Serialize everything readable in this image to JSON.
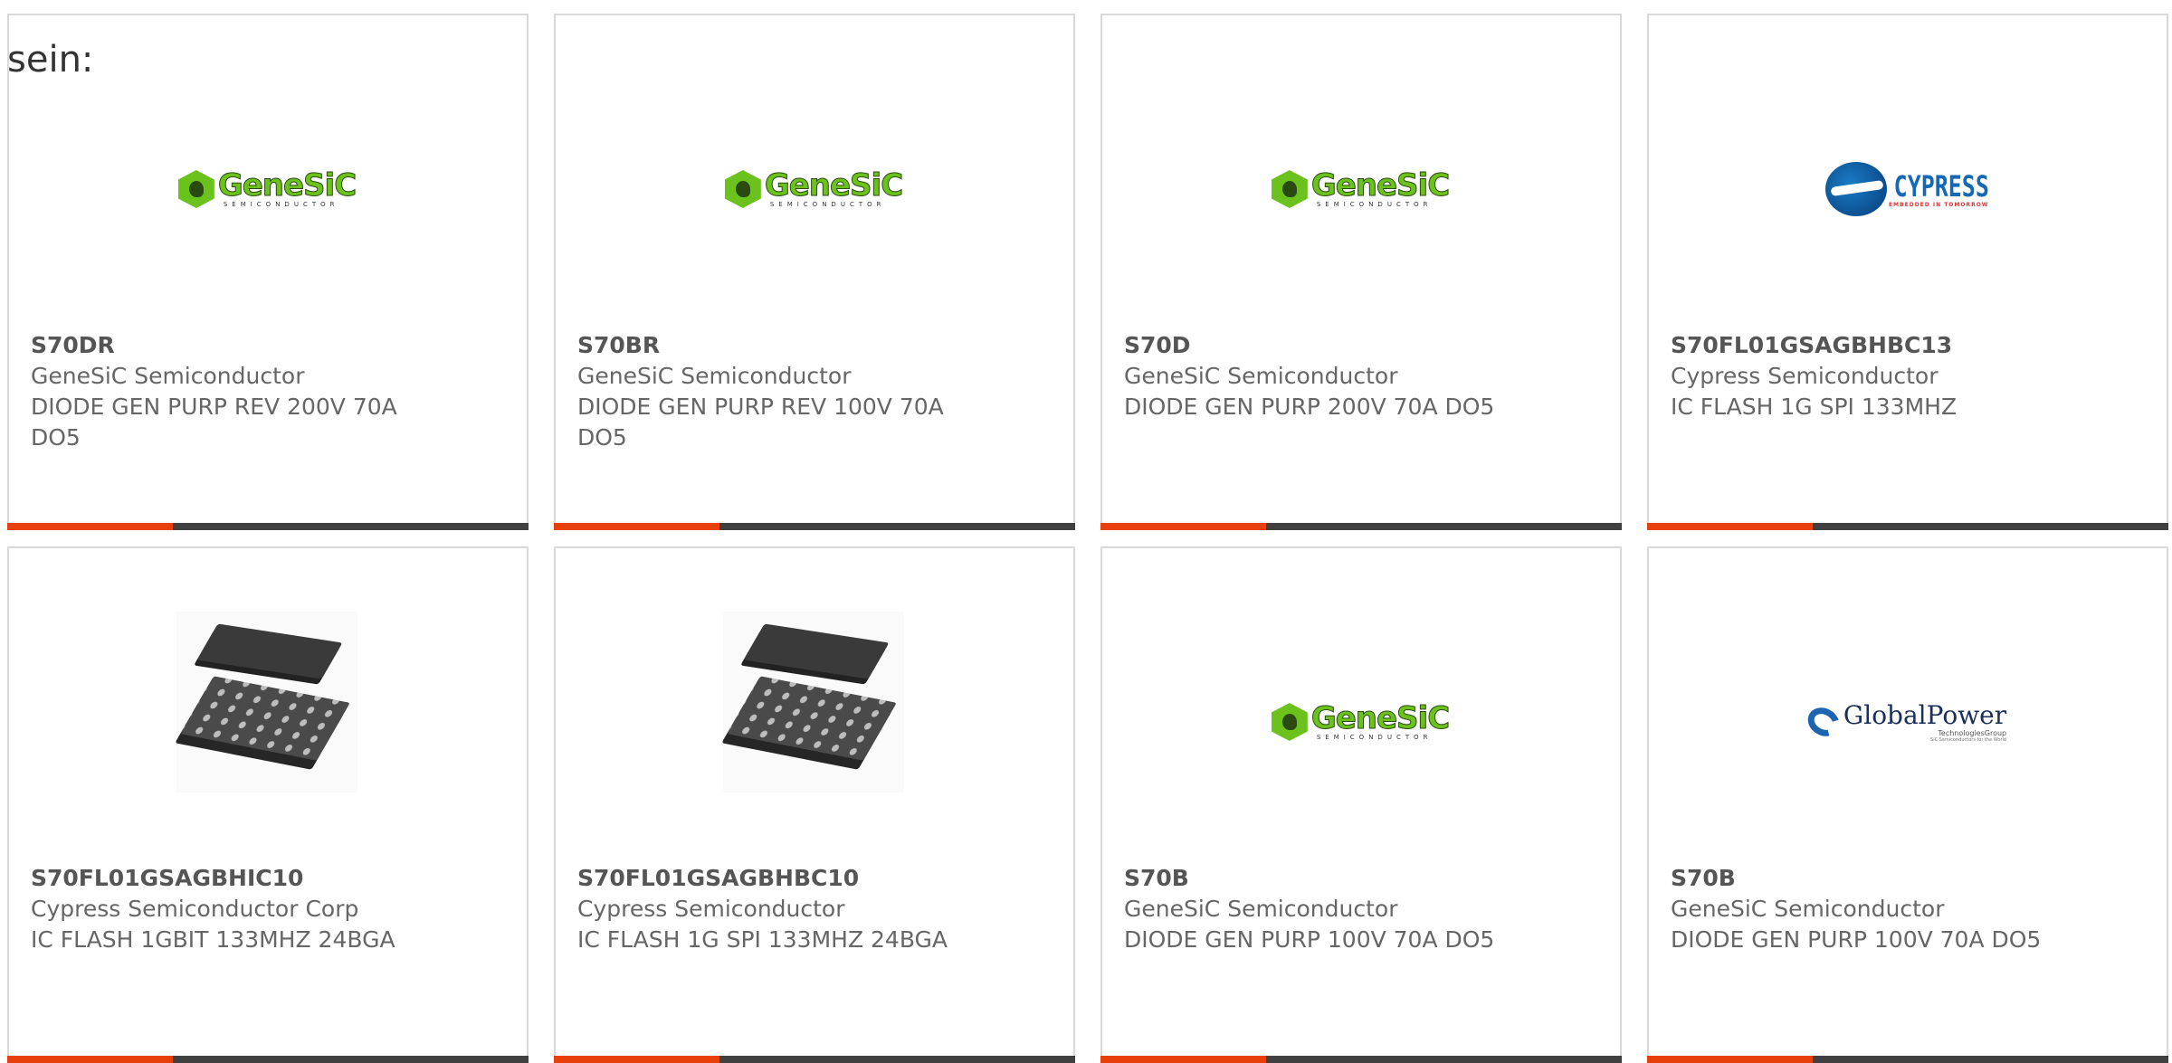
{
  "intro_text": "sein:",
  "colors": {
    "accent": "#e8400b",
    "bar": "#404040",
    "genesic_green": "#6cc21d",
    "cypress_blue": "#1568b4"
  },
  "logos": {
    "genesic": {
      "name": "GeneSiC",
      "sub": "SEMICONDUCTOR"
    },
    "cypress": {
      "name": "CYPRESS",
      "tag": "EMBEDDED IN TOMORROW"
    },
    "globalpower": {
      "name": "GlobalPower",
      "sub": "TechnologiesGroup",
      "sub2": "SiC Semiconductors for the World"
    }
  },
  "products": [
    {
      "part": "S70DR",
      "manufacturer": "GeneSiC Semiconductor",
      "description": "DIODE GEN PURP REV 200V 70A DO5",
      "image": "genesic-logo"
    },
    {
      "part": "S70BR",
      "manufacturer": "GeneSiC Semiconductor",
      "description": "DIODE GEN PURP REV 100V 70A DO5",
      "image": "genesic-logo"
    },
    {
      "part": "S70D",
      "manufacturer": "GeneSiC Semiconductor",
      "description": "DIODE GEN PURP 200V 70A DO5",
      "image": "genesic-logo"
    },
    {
      "part": "S70FL01GSAGBHBC13",
      "manufacturer": "Cypress Semiconductor",
      "description": "IC FLASH 1G SPI 133MHZ",
      "image": "cypress-logo"
    },
    {
      "part": "S70FL01GSAGBHIC10",
      "manufacturer": "Cypress Semiconductor Corp",
      "description": "IC FLASH 1GBIT 133MHZ 24BGA",
      "image": "bga-chip"
    },
    {
      "part": "S70FL01GSAGBHBC10",
      "manufacturer": "Cypress Semiconductor",
      "description": "IC FLASH 1G SPI 133MHZ 24BGA",
      "image": "bga-chip"
    },
    {
      "part": "S70B",
      "manufacturer": "GeneSiC Semiconductor",
      "description": "DIODE GEN PURP 100V 70A DO5",
      "image": "genesic-logo"
    },
    {
      "part": "S70B",
      "manufacturer": "GeneSiC Semiconductor",
      "description": "DIODE GEN PURP 100V 70A DO5",
      "image": "globalpower-logo"
    }
  ]
}
